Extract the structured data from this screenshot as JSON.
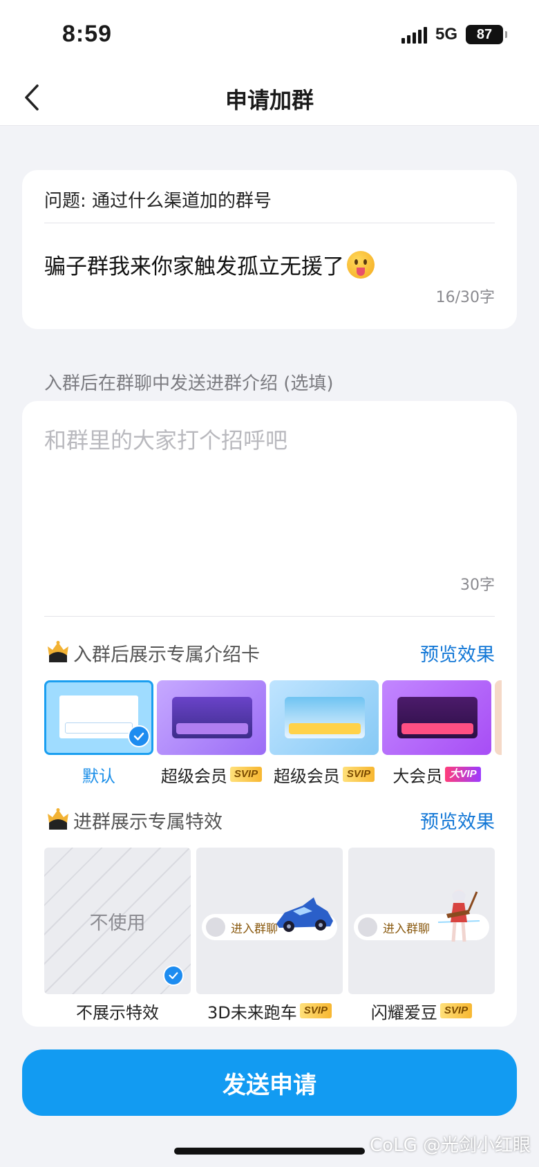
{
  "status_bar": {
    "time": "8:59",
    "network": "5G",
    "battery": "87"
  },
  "nav": {
    "title": "申请加群",
    "back_icon": "chevron-left-icon"
  },
  "question": {
    "label": "问题: 通过什么渠道加的群号",
    "answer": "骗子群我来你家触发孤立无援了",
    "answer_emoji": "tongue-out-emoji",
    "count": "16/30字"
  },
  "intro": {
    "hint": "入群后在群聊中发送进群介绍 (选填)",
    "placeholder": "和群里的大家打个招呼吧",
    "count": "30字"
  },
  "intro_card_section": {
    "title": "入群后展示专属介绍卡",
    "preview": "预览效果",
    "icon": "crown-icon",
    "cards": [
      {
        "label": "默认",
        "badge": "",
        "selected": true
      },
      {
        "label": "超级会员",
        "badge": "SVIP",
        "selected": false
      },
      {
        "label": "超级会员",
        "badge": "SVIP",
        "selected": false
      },
      {
        "label": "大会员",
        "badge": "大VIP",
        "selected": false
      }
    ]
  },
  "effects_section": {
    "title": "进群展示专属特效",
    "preview": "预览效果",
    "icon": "crown-icon",
    "none_text": "不使用",
    "enter_text": "进入群聊",
    "effects": [
      {
        "label": "不展示特效",
        "badge": "",
        "selected": true
      },
      {
        "label": "3D未来跑车",
        "badge": "SVIP",
        "selected": false
      },
      {
        "label": "闪耀爱豆",
        "badge": "SVIP",
        "selected": false
      }
    ]
  },
  "send_button": "发送申请",
  "watermark": "CoLG @光剑小红眼",
  "colors": {
    "accent": "#129bf2",
    "link": "#1277d6",
    "background": "#f2f3f7"
  }
}
